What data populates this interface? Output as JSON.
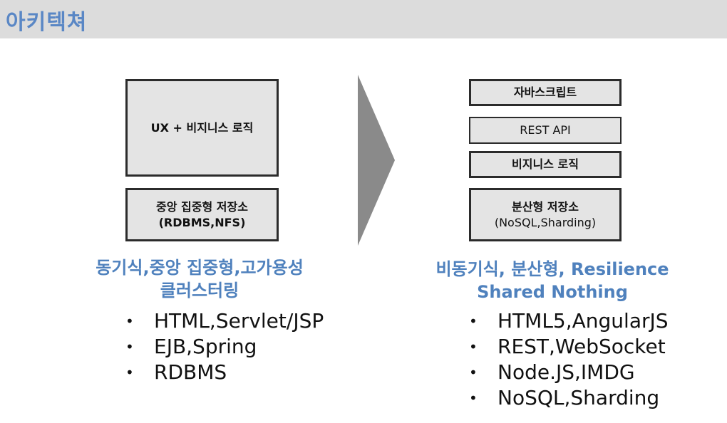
{
  "title": "아키텍쳐",
  "left": {
    "box_top": "UX + 비지니스 로직",
    "box_bottom_line1": "중앙 집중형 저장소",
    "box_bottom_line2": "(RDBMS,NFS)",
    "heading_line1": "동기식,중앙 집중형,고가용성",
    "heading_line2": "클러스터링",
    "bullets": [
      "HTML,Servlet/JSP",
      "EJB,Spring",
      "RDBMS"
    ]
  },
  "right": {
    "box1": "자바스크립트",
    "box2": "REST API",
    "box3": "비지니스 로직",
    "box4_line1": "분산형 저장소",
    "box4_line2": "(NoSQL,Sharding)",
    "heading_line1": "비동기식, 분산형, Resilience",
    "heading_line2": "Shared Nothing",
    "bullets": [
      "HTML5,AngularJS",
      "REST,WebSocket",
      "Node.JS,IMDG",
      "NoSQL,Sharding"
    ]
  },
  "bullet_symbol": "•",
  "colors": {
    "accent": "#4f81bd",
    "title": "#5a87c5",
    "box_fill": "#e4e4e4",
    "arrow": "#8a8a8a"
  }
}
